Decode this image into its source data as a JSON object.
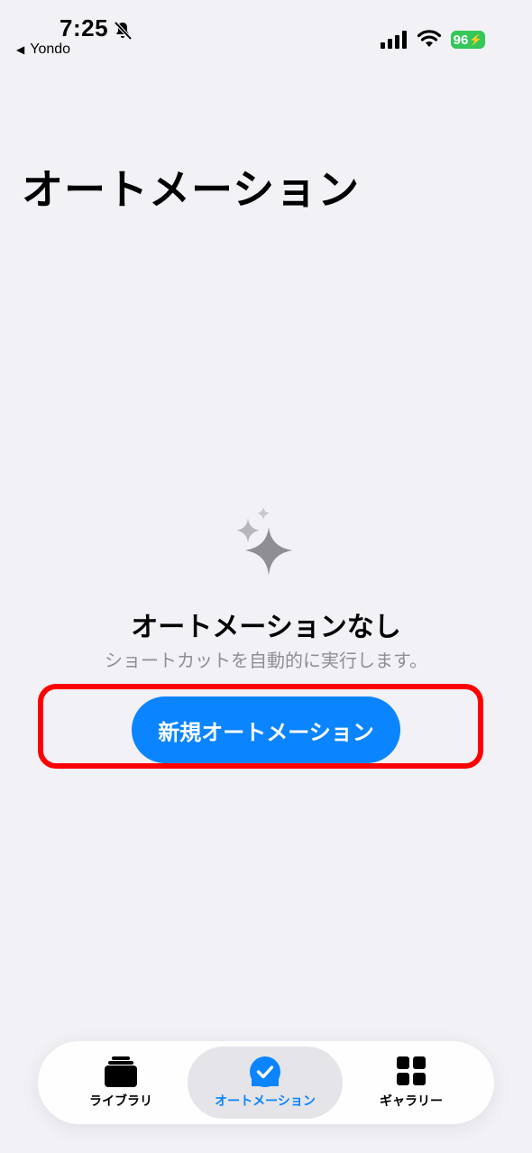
{
  "status_bar": {
    "time": "7:25",
    "back_app": "Yondo",
    "battery": "96"
  },
  "page": {
    "title": "オートメーション"
  },
  "empty_state": {
    "title": "オートメーションなし",
    "subtitle": "ショートカットを自動的に実行します。",
    "button_label": "新規オートメーション"
  },
  "tab_bar": {
    "tabs": [
      {
        "label": "ライブラリ",
        "icon": "library-stack-icon"
      },
      {
        "label": "オートメーション",
        "icon": "automation-check-icon"
      },
      {
        "label": "ギャラリー",
        "icon": "gallery-grid-icon"
      }
    ],
    "active_index": 1
  },
  "colors": {
    "accent": "#0a84ff",
    "background": "#f1f1f6",
    "highlight": "#ff0000",
    "battery": "#34c759"
  }
}
